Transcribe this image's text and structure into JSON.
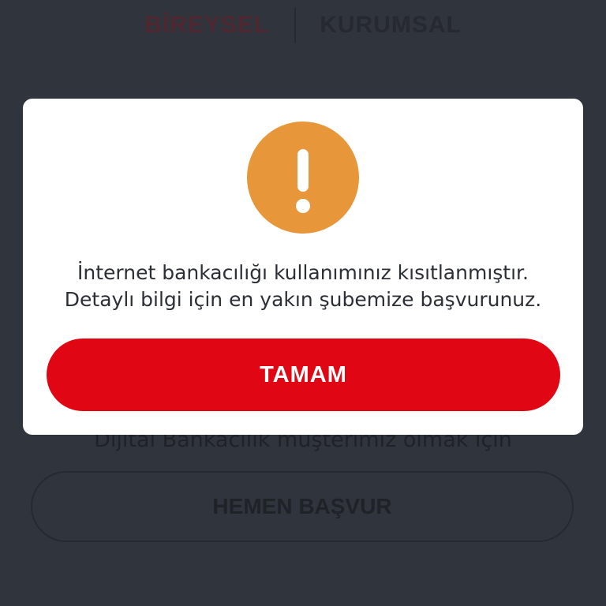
{
  "tabs": {
    "individual": "BİREYSEL",
    "corporate": "KURUMSAL"
  },
  "background": {
    "info_text": "Dijital Bankacılık müşterimiz olmak için",
    "apply_button": "HEMEN BAŞVUR"
  },
  "dialog": {
    "icon": "exclamation-icon",
    "icon_color": "#e8963a",
    "message_line1": "İnternet bankacılığı kullanımınız kısıtlanmıştır.",
    "message_line2": "Detaylı bilgi için en yakın şubemize başvurunuz.",
    "ok_button": "TAMAM",
    "ok_button_color": "#e00613"
  }
}
